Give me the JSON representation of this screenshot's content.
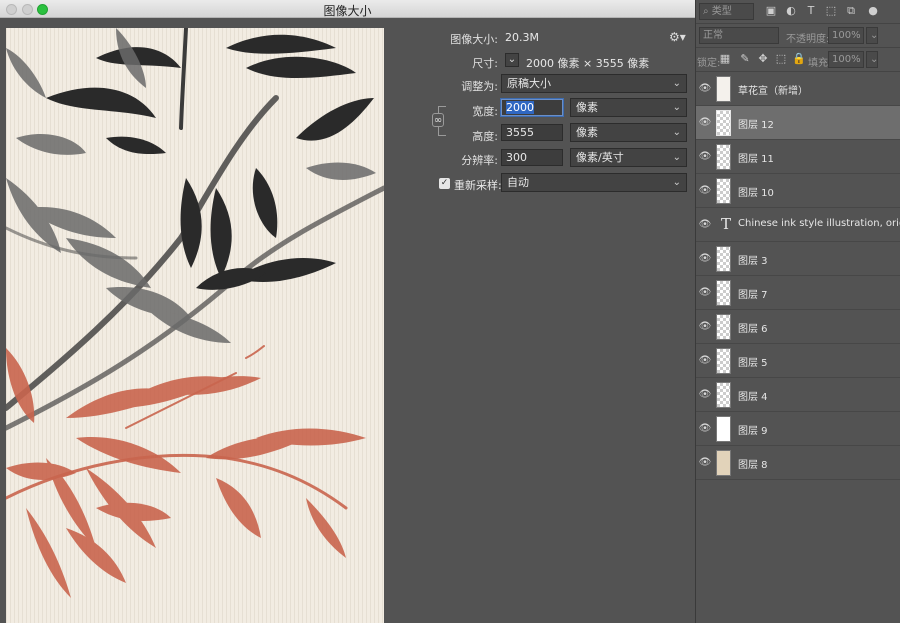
{
  "window": {
    "title": "图像大小"
  },
  "image_size": {
    "label": "图像大小:",
    "value": "20.3M",
    "dimensions_label": "尺寸:",
    "dimensions_value": "2000 像素 × 3555 像素",
    "fit_label": "调整为:",
    "fit_value": "原稿大小",
    "width_label": "宽度:",
    "width_value": "2000",
    "width_unit": "像素",
    "height_label": "高度:",
    "height_value": "3555",
    "height_unit": "像素",
    "resolution_label": "分辨率:",
    "resolution_value": "300",
    "resolution_unit": "像素/英寸",
    "resample_label": "重新采样:",
    "resample_value": "自动",
    "resample_checked": true
  },
  "layers_panel": {
    "filter_kind": "类型",
    "blend_mode": "正常",
    "opacity_label": "不透明度:",
    "opacity_value": "100%",
    "lock_label": "锁定:",
    "fill_label": "填充:",
    "fill_value": "100%",
    "layers": [
      {
        "name": "草花宣（新增）",
        "thumb": "plain-white",
        "active": false
      },
      {
        "name": "图层 12",
        "thumb": "transparent",
        "active": true
      },
      {
        "name": "图层 11",
        "thumb": "transparent",
        "active": false
      },
      {
        "name": "图层 10",
        "thumb": "transparent",
        "active": false
      },
      {
        "name": "Chinese ink style illustration, origin",
        "thumb": "text",
        "active": false
      },
      {
        "name": "图层 3",
        "thumb": "transparent",
        "active": false
      },
      {
        "name": "图层 7",
        "thumb": "transparent",
        "active": false
      },
      {
        "name": "图层 6",
        "thumb": "transparent",
        "active": false
      },
      {
        "name": "图层 5",
        "thumb": "transparent",
        "active": false
      },
      {
        "name": "图层 4",
        "thumb": "transparent",
        "active": false
      },
      {
        "name": "图层 9",
        "thumb": "white",
        "active": false
      },
      {
        "name": "图层 8",
        "thumb": "beige",
        "active": false
      }
    ]
  },
  "icons": {
    "eye": "eye-icon",
    "link": "link-icon",
    "gear": "gear-icon",
    "text_layer": "text-layer-icon",
    "checkbox": "checkbox-icon"
  },
  "colors": {
    "panel_bg": "#535353",
    "selection_blue": "#2f67c2",
    "paper": "#f1ebe1",
    "ink_red": "#c9654e",
    "beige_swatch": "#e2d3ba"
  }
}
